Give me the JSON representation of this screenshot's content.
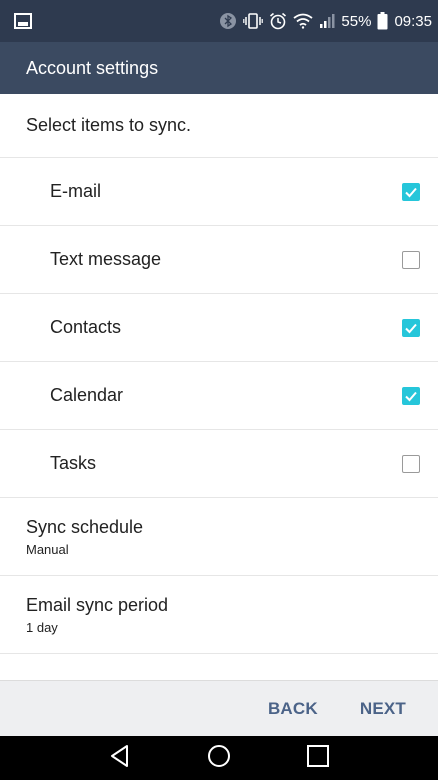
{
  "status_bar": {
    "battery_percent": "55%",
    "time": "09:35",
    "icons": [
      "gallery-icon",
      "bluetooth-icon",
      "vibrate-icon",
      "alarm-icon",
      "wifi-icon",
      "signal-icon",
      "battery-icon"
    ]
  },
  "app_bar": {
    "title": "Account settings"
  },
  "section": {
    "header": "Select items to sync."
  },
  "sync_items": [
    {
      "label": "E-mail",
      "checked": true
    },
    {
      "label": "Text message",
      "checked": false
    },
    {
      "label": "Contacts",
      "checked": true
    },
    {
      "label": "Calendar",
      "checked": true
    },
    {
      "label": "Tasks",
      "checked": false
    }
  ],
  "preferences": [
    {
      "title": "Sync schedule",
      "summary": "Manual"
    },
    {
      "title": "Email sync period",
      "summary": "1 day"
    }
  ],
  "bottom_bar": {
    "back_label": "BACK",
    "next_label": "NEXT"
  },
  "nav_bar": {
    "icons": [
      "back-icon",
      "home-icon",
      "recents-icon"
    ]
  },
  "colors": {
    "checkbox_accent": "#26c6da",
    "app_bar": "#3b4a61",
    "status_bar": "#2e3a4f",
    "button_text": "#4b6388"
  }
}
